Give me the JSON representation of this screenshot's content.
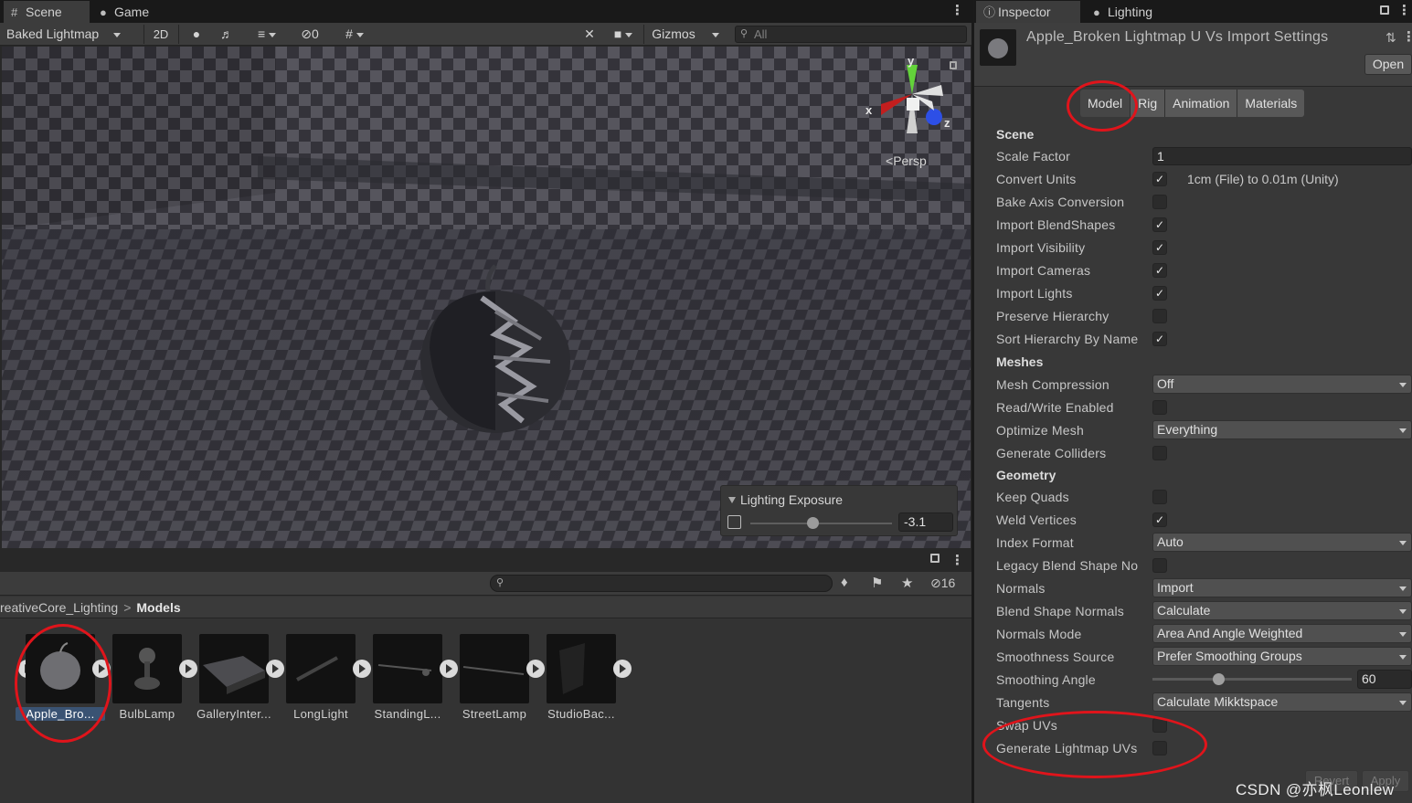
{
  "scene_window": {
    "tabs": [
      {
        "label": "Scene",
        "icon": "grid-icon"
      },
      {
        "label": "Game",
        "icon": "gamepad-icon"
      }
    ],
    "toolbar": {
      "draw_mode": "Baked Lightmap",
      "mode_2d": "2D",
      "hidden_count": "0",
      "gizmos_label": "Gizmos",
      "search_placeholder": "All"
    },
    "gizmo": {
      "x": "x",
      "y": "y",
      "z": "z",
      "projection": "Persp"
    },
    "exposure_overlay": {
      "title": "Lighting Exposure",
      "value": "-3.1",
      "slider_fraction": 0.44
    }
  },
  "project_window": {
    "visible_count": "16",
    "breadcrumb": [
      "reativeCore_Lighting",
      "Models"
    ],
    "assets": [
      {
        "name": "Apple_Bro...",
        "selected": true
      },
      {
        "name": "BulbLamp",
        "selected": false
      },
      {
        "name": "GalleryInter...",
        "selected": false
      },
      {
        "name": "LongLight",
        "selected": false
      },
      {
        "name": "StandingL...",
        "selected": false
      },
      {
        "name": "StreetLamp",
        "selected": false
      },
      {
        "name": "StudioBac...",
        "selected": false
      }
    ]
  },
  "inspector": {
    "tabs": [
      {
        "label": "Inspector",
        "icon": "info-icon"
      },
      {
        "label": "Lighting",
        "icon": "bulb-icon"
      }
    ],
    "header": {
      "title": "Apple_Broken Lightmap U Vs Import Settings",
      "open_label": "Open"
    },
    "import_tabs": [
      "Model",
      "Rig",
      "Animation",
      "Materials"
    ],
    "active_import_tab": "Model",
    "sections": {
      "scene": "Scene",
      "meshes": "Meshes",
      "geometry": "Geometry"
    },
    "properties": {
      "scale_factor": {
        "label": "Scale Factor",
        "value": "1"
      },
      "convert_units": {
        "label": "Convert Units",
        "checked": true,
        "note": "1cm (File) to 0.01m (Unity)"
      },
      "bake_axis": {
        "label": "Bake Axis Conversion",
        "checked": false
      },
      "import_blendshapes": {
        "label": "Import BlendShapes",
        "checked": true
      },
      "import_visibility": {
        "label": "Import Visibility",
        "checked": true
      },
      "import_cameras": {
        "label": "Import Cameras",
        "checked": true
      },
      "import_lights": {
        "label": "Import Lights",
        "checked": true
      },
      "preserve_hierarchy": {
        "label": "Preserve Hierarchy",
        "checked": false
      },
      "sort_hierarchy": {
        "label": "Sort Hierarchy By Name",
        "checked": true
      },
      "mesh_compression": {
        "label": "Mesh Compression",
        "value": "Off"
      },
      "read_write": {
        "label": "Read/Write Enabled",
        "checked": false
      },
      "optimize_mesh": {
        "label": "Optimize Mesh",
        "value": "Everything"
      },
      "generate_colliders": {
        "label": "Generate Colliders",
        "checked": false
      },
      "keep_quads": {
        "label": "Keep Quads",
        "checked": false
      },
      "weld_vertices": {
        "label": "Weld Vertices",
        "checked": true
      },
      "index_format": {
        "label": "Index Format",
        "value": "Auto"
      },
      "legacy_blend": {
        "label": "Legacy Blend Shape No",
        "checked": false
      },
      "normals": {
        "label": "Normals",
        "value": "Import"
      },
      "blend_shape_normals": {
        "label": "Blend Shape Normals",
        "value": "Calculate"
      },
      "normals_mode": {
        "label": "Normals Mode",
        "value": "Area And Angle Weighted"
      },
      "smoothness_source": {
        "label": "Smoothness Source",
        "value": "Prefer Smoothing Groups"
      },
      "smoothing_angle": {
        "label": "Smoothing Angle",
        "value": "60",
        "fraction": 0.33
      },
      "tangents": {
        "label": "Tangents",
        "value": "Calculate Mikktspace"
      },
      "swap_uvs": {
        "label": "Swap UVs",
        "checked": false
      },
      "generate_lightmap_uvs": {
        "label": "Generate Lightmap UVs",
        "checked": false
      }
    },
    "footer": {
      "revert_label": "Revert",
      "apply_label": "Apply"
    }
  },
  "watermark": "CSDN @亦枫Leonlew",
  "colors": {
    "highlight_ring": "#e0141b",
    "selection": "#3a5373",
    "panel": "#383838"
  }
}
